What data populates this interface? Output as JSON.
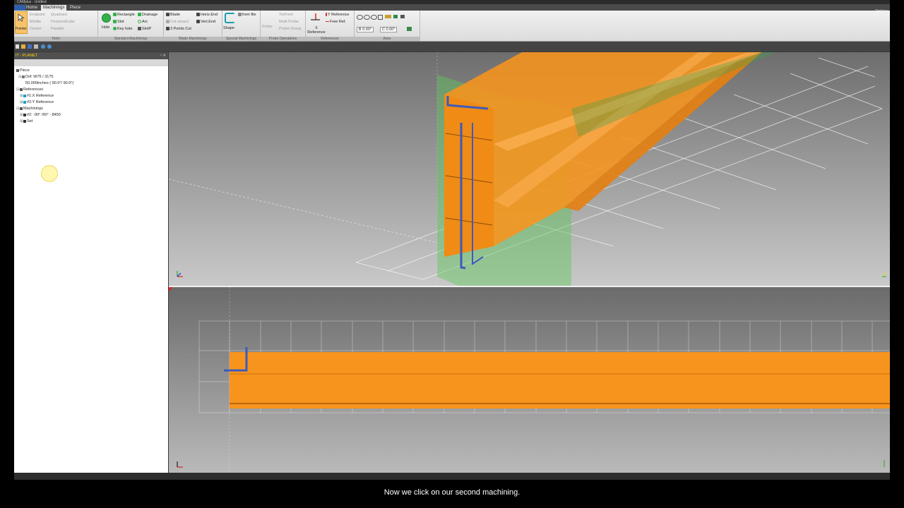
{
  "window": {
    "title": "CAMplus - Untitled"
  },
  "tabs": [
    {
      "label": "Home",
      "active": false
    },
    {
      "label": "Machinings",
      "active": true
    },
    {
      "label": "Piece",
      "active": false
    }
  ],
  "options_label": "Options",
  "ribbon": {
    "tools": {
      "label": "Tools",
      "pointer": "Pointer",
      "items": [
        "Endpoint",
        "Quadrant",
        "Middle",
        "Perpendicular",
        "Center",
        "Parallel"
      ]
    },
    "standard": {
      "label": "Standard Machinings",
      "hole": "Hole",
      "items": [
        "Rectangle",
        "Drainage",
        "Slot",
        "Arc",
        "Key hole",
        "SlotP"
      ]
    },
    "blade": {
      "label": "Blade Machinings",
      "items": [
        "Blade",
        "Horiz.End",
        "Cut wizard",
        "Vert.End",
        "3 Points Cut"
      ]
    },
    "special": {
      "label": "Special Machinings",
      "shape": "Shape",
      "from_file": "from file"
    },
    "probe": {
      "label": "Probe Operations",
      "probe": "Probe",
      "items": [
        "TiePoint",
        "Multi Probe",
        "Probe Group"
      ]
    },
    "references": {
      "label": "References",
      "x_reference": "X Reference",
      "y_reference": "Y Reference",
      "free_ref": "Free Ref."
    },
    "axes": {
      "label": "Axes",
      "b_value": "B 0.00°",
      "c_value": "C 0.00°"
    }
  },
  "panel": {
    "title": "IT - PLANET",
    "tree": [
      {
        "label": "Piece",
        "level": 0
      },
      {
        "label": "Dxf: W75 / 3175",
        "level": 1
      },
      {
        "label": "50,000inches ( 90.0°/ 90.0°)",
        "level": 2
      },
      {
        "label": "References",
        "level": 0
      },
      {
        "label": "#1:X Reference",
        "level": 1
      },
      {
        "label": "#2:Y Reference",
        "level": 1
      },
      {
        "label": "Machinings",
        "level": 0
      },
      {
        "label": "#2: -90° /90° - 8450",
        "level": 1
      },
      {
        "label": "Set",
        "level": 1
      }
    ]
  },
  "colors": {
    "beam": "#f7941d",
    "green_plane": "#5fc85a",
    "blue_tool": "#3b5bbd",
    "panel_title": "#ffd400"
  },
  "subtitle": "Now we click on our second machining."
}
